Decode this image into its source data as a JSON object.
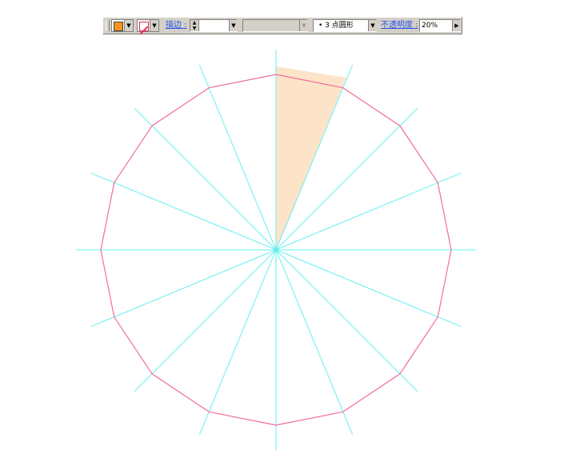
{
  "toolbar": {
    "fill_color": "#f7941d",
    "stroke_color": "#e0305a",
    "stroke_label": "描边 :",
    "brush_style": "• 3 点圆形",
    "opacity_label": "不透明度 :",
    "opacity_value": "20%"
  },
  "icons": {
    "fill_dropdown": "chevron-down-icon",
    "stroke_dropdown": "chevron-down-icon",
    "stroke_weight_spinner": "spinner-icon",
    "opacity_menu": "triangle-right-icon",
    "no_stroke": "slash-icon"
  },
  "canvas": {
    "polygon_sides": 16,
    "guide_lines": 8,
    "highlighted_wedges": 1,
    "polygon_color": "#f06d9a",
    "guide_color": "#66f0f0",
    "wedge_color": "#fde3c8"
  }
}
